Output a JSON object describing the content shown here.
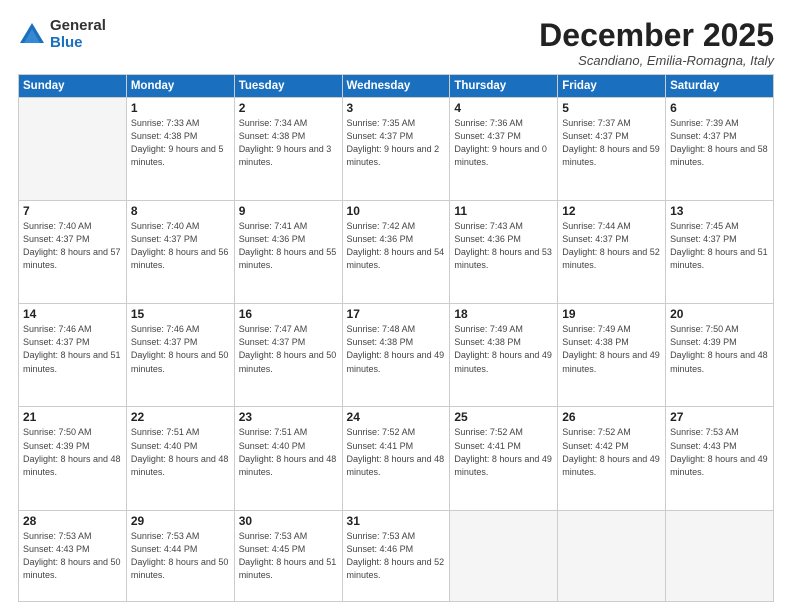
{
  "logo": {
    "general": "General",
    "blue": "Blue"
  },
  "title": "December 2025",
  "location": "Scandiano, Emilia-Romagna, Italy",
  "days_header": [
    "Sunday",
    "Monday",
    "Tuesday",
    "Wednesday",
    "Thursday",
    "Friday",
    "Saturday"
  ],
  "weeks": [
    [
      {
        "num": "",
        "empty": true
      },
      {
        "num": "1",
        "sunrise": "7:33 AM",
        "sunset": "4:38 PM",
        "daylight": "9 hours and 5 minutes."
      },
      {
        "num": "2",
        "sunrise": "7:34 AM",
        "sunset": "4:38 PM",
        "daylight": "9 hours and 3 minutes."
      },
      {
        "num": "3",
        "sunrise": "7:35 AM",
        "sunset": "4:37 PM",
        "daylight": "9 hours and 2 minutes."
      },
      {
        "num": "4",
        "sunrise": "7:36 AM",
        "sunset": "4:37 PM",
        "daylight": "9 hours and 0 minutes."
      },
      {
        "num": "5",
        "sunrise": "7:37 AM",
        "sunset": "4:37 PM",
        "daylight": "8 hours and 59 minutes."
      },
      {
        "num": "6",
        "sunrise": "7:39 AM",
        "sunset": "4:37 PM",
        "daylight": "8 hours and 58 minutes."
      }
    ],
    [
      {
        "num": "7",
        "sunrise": "7:40 AM",
        "sunset": "4:37 PM",
        "daylight": "8 hours and 57 minutes."
      },
      {
        "num": "8",
        "sunrise": "7:40 AM",
        "sunset": "4:37 PM",
        "daylight": "8 hours and 56 minutes."
      },
      {
        "num": "9",
        "sunrise": "7:41 AM",
        "sunset": "4:36 PM",
        "daylight": "8 hours and 55 minutes."
      },
      {
        "num": "10",
        "sunrise": "7:42 AM",
        "sunset": "4:36 PM",
        "daylight": "8 hours and 54 minutes."
      },
      {
        "num": "11",
        "sunrise": "7:43 AM",
        "sunset": "4:36 PM",
        "daylight": "8 hours and 53 minutes."
      },
      {
        "num": "12",
        "sunrise": "7:44 AM",
        "sunset": "4:37 PM",
        "daylight": "8 hours and 52 minutes."
      },
      {
        "num": "13",
        "sunrise": "7:45 AM",
        "sunset": "4:37 PM",
        "daylight": "8 hours and 51 minutes."
      }
    ],
    [
      {
        "num": "14",
        "sunrise": "7:46 AM",
        "sunset": "4:37 PM",
        "daylight": "8 hours and 51 minutes."
      },
      {
        "num": "15",
        "sunrise": "7:46 AM",
        "sunset": "4:37 PM",
        "daylight": "8 hours and 50 minutes."
      },
      {
        "num": "16",
        "sunrise": "7:47 AM",
        "sunset": "4:37 PM",
        "daylight": "8 hours and 50 minutes."
      },
      {
        "num": "17",
        "sunrise": "7:48 AM",
        "sunset": "4:38 PM",
        "daylight": "8 hours and 49 minutes."
      },
      {
        "num": "18",
        "sunrise": "7:49 AM",
        "sunset": "4:38 PM",
        "daylight": "8 hours and 49 minutes."
      },
      {
        "num": "19",
        "sunrise": "7:49 AM",
        "sunset": "4:38 PM",
        "daylight": "8 hours and 49 minutes."
      },
      {
        "num": "20",
        "sunrise": "7:50 AM",
        "sunset": "4:39 PM",
        "daylight": "8 hours and 48 minutes."
      }
    ],
    [
      {
        "num": "21",
        "sunrise": "7:50 AM",
        "sunset": "4:39 PM",
        "daylight": "8 hours and 48 minutes."
      },
      {
        "num": "22",
        "sunrise": "7:51 AM",
        "sunset": "4:40 PM",
        "daylight": "8 hours and 48 minutes."
      },
      {
        "num": "23",
        "sunrise": "7:51 AM",
        "sunset": "4:40 PM",
        "daylight": "8 hours and 48 minutes."
      },
      {
        "num": "24",
        "sunrise": "7:52 AM",
        "sunset": "4:41 PM",
        "daylight": "8 hours and 48 minutes."
      },
      {
        "num": "25",
        "sunrise": "7:52 AM",
        "sunset": "4:41 PM",
        "daylight": "8 hours and 49 minutes."
      },
      {
        "num": "26",
        "sunrise": "7:52 AM",
        "sunset": "4:42 PM",
        "daylight": "8 hours and 49 minutes."
      },
      {
        "num": "27",
        "sunrise": "7:53 AM",
        "sunset": "4:43 PM",
        "daylight": "8 hours and 49 minutes."
      }
    ],
    [
      {
        "num": "28",
        "sunrise": "7:53 AM",
        "sunset": "4:43 PM",
        "daylight": "8 hours and 50 minutes."
      },
      {
        "num": "29",
        "sunrise": "7:53 AM",
        "sunset": "4:44 PM",
        "daylight": "8 hours and 50 minutes."
      },
      {
        "num": "30",
        "sunrise": "7:53 AM",
        "sunset": "4:45 PM",
        "daylight": "8 hours and 51 minutes."
      },
      {
        "num": "31",
        "sunrise": "7:53 AM",
        "sunset": "4:46 PM",
        "daylight": "8 hours and 52 minutes."
      },
      {
        "num": "",
        "empty": true
      },
      {
        "num": "",
        "empty": true
      },
      {
        "num": "",
        "empty": true
      }
    ]
  ]
}
